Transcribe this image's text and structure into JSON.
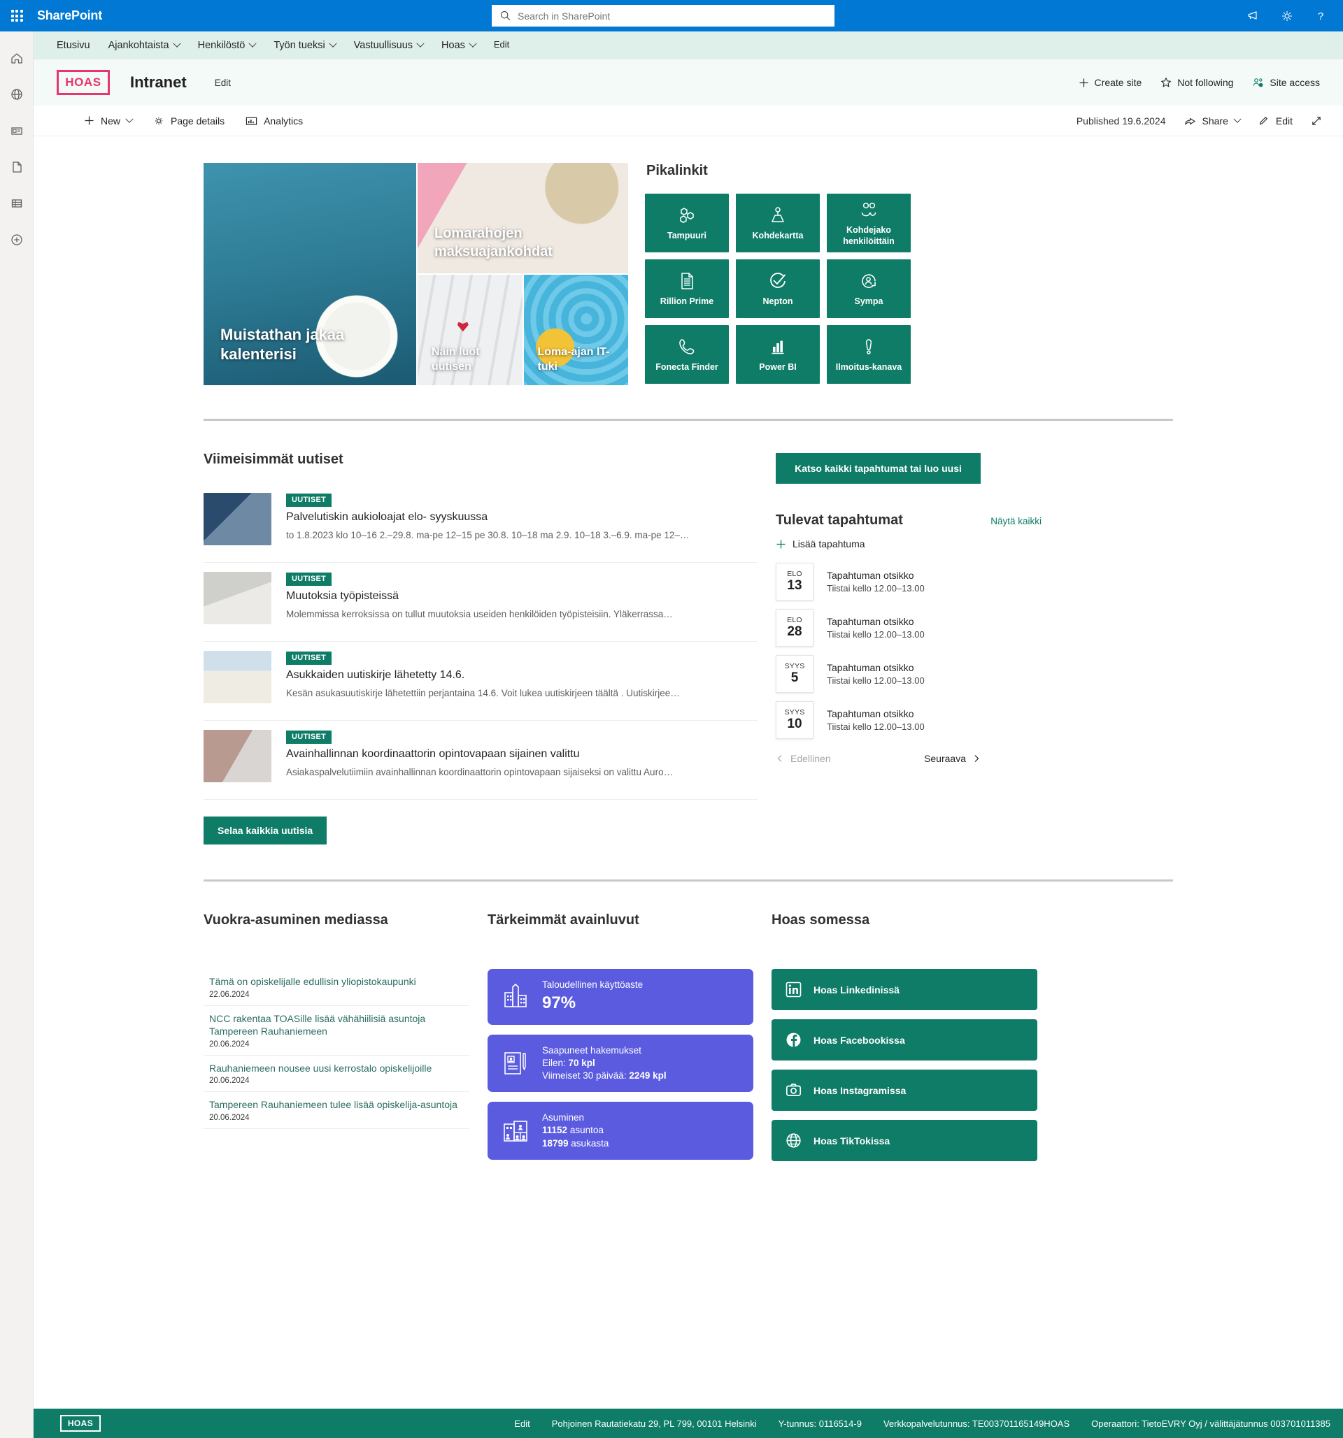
{
  "suite": {
    "brand": "SharePoint",
    "search_placeholder": "Search in SharePoint",
    "icons": [
      "megaphone-icon",
      "gear-icon",
      "help-icon"
    ]
  },
  "rail": {
    "items": [
      "home-icon",
      "globe-icon",
      "news-icon",
      "page-icon",
      "list-icon",
      "create-icon"
    ]
  },
  "topnav": {
    "items": [
      {
        "label": "Etusivu",
        "has_chevron": false
      },
      {
        "label": "Ajankohtaista",
        "has_chevron": true
      },
      {
        "label": "Henkilöstö",
        "has_chevron": true
      },
      {
        "label": "Työn tueksi",
        "has_chevron": true
      },
      {
        "label": "Vastuullisuus",
        "has_chevron": true
      },
      {
        "label": "Hoas",
        "has_chevron": true
      }
    ],
    "edit": "Edit"
  },
  "site_header": {
    "logo_text": "HOAS",
    "title": "Intranet",
    "edit": "Edit",
    "actions": [
      {
        "label": "Create site",
        "icon": "plus-icon"
      },
      {
        "label": "Not following",
        "icon": "star-icon"
      },
      {
        "label": "Site access",
        "icon": "people-icon"
      }
    ]
  },
  "cmdbar": {
    "new_label": "New",
    "page_details_label": "Page details",
    "analytics_label": "Analytics",
    "published": "Published 19.6.2024",
    "share_label": "Share",
    "edit_label": "Edit"
  },
  "hero": {
    "tiles": [
      {
        "caption": "Muistathan jakaa kalenterisi",
        "theme": "t-clock",
        "size": "big"
      },
      {
        "caption": "Lomarahojen maksuajankohdat",
        "theme": "t-phone",
        "size": "wide"
      },
      {
        "caption": "Näin luot uutisen",
        "theme": "t-keyboard",
        "size": "small"
      },
      {
        "caption": "Loma-ajan IT-tuki",
        "theme": "t-pool",
        "size": "small"
      }
    ]
  },
  "quicklinks": {
    "title": "Pikalinkit",
    "items": [
      {
        "label": "Tampuuri",
        "icon": "hexagons-icon"
      },
      {
        "label": "Kohdekartta",
        "icon": "map-pin-icon"
      },
      {
        "label": "Kohdejako henkilöittäin",
        "icon": "people-icon"
      },
      {
        "label": "Rillion Prime",
        "icon": "document-icon"
      },
      {
        "label": "Nepton",
        "icon": "check-circle-icon"
      },
      {
        "label": "Sympa",
        "icon": "person-refresh-icon"
      },
      {
        "label": "Fonecta Finder",
        "icon": "phone-icon"
      },
      {
        "label": "Power BI",
        "icon": "bar-chart-icon"
      },
      {
        "label": "Ilmoitus-kanava",
        "icon": "alert-icon"
      }
    ]
  },
  "news": {
    "title": "Viimeisimmät uutiset",
    "browse_all": "Selaa kaikkia uutisia",
    "items": [
      {
        "badge": "UUTISET",
        "title": "Palvelutiskin aukioloajat elo- syyskuussa",
        "desc": "to 1.8.2023 klo 10–16 2.–29.8. ma-pe 12–15 pe 30.8. 10–18 ma 2.9. 10–18 3.–6.9. ma-pe 12–…",
        "thumb": "thumb-a"
      },
      {
        "badge": "UUTISET",
        "title": "Muutoksia työpisteissä",
        "desc": "Molemmissa kerroksissa on tullut muutoksia useiden henkilöiden työpisteisiin. Yläkerrassa…",
        "thumb": "thumb-b"
      },
      {
        "badge": "UUTISET",
        "title": "Asukkaiden uutiskirje lähetetty 14.6.",
        "desc": "Kesän asukasuutiskirje lähetettiin perjantaina 14.6. Voit lukea uutiskirjeen täältä . Uutiskirjee…",
        "thumb": "thumb-c"
      },
      {
        "badge": "UUTISET",
        "title": "Avainhallinnan koordinaattorin opintovapaan sijainen valittu",
        "desc": "Asiakaspalvelutiimiin avainhallinnan koordinaattorin opintovapaan sijaiseksi on valittu Auro…",
        "thumb": "thumb-d"
      }
    ]
  },
  "events": {
    "cta": "Katso kaikki tapahtumat tai luo uusi",
    "title": "Tulevat tapahtumat",
    "show_all": "Näytä kaikki",
    "add": "Lisää tapahtuma",
    "prev": "Edellinen",
    "next": "Seuraava",
    "items": [
      {
        "month": "ELO",
        "day": "13",
        "title": "Tapahtuman otsikko",
        "time": "Tiistai kello 12.00–13.00"
      },
      {
        "month": "ELO",
        "day": "28",
        "title": "Tapahtuman otsikko",
        "time": "Tiistai kello 12.00–13.00"
      },
      {
        "month": "SYYS",
        "day": "5",
        "title": "Tapahtuman otsikko",
        "time": "Tiistai kello 12.00–13.00"
      },
      {
        "month": "SYYS",
        "day": "10",
        "title": "Tapahtuman otsikko",
        "time": "Tiistai kello 12.00–13.00"
      }
    ]
  },
  "media": {
    "title": "Vuokra-asuminen mediassa",
    "items": [
      {
        "title": "Tämä on opiskelijalle edullisin yliopistokaupunki",
        "date": "22.06.2024"
      },
      {
        "title": "NCC rakentaa TOASille lisää vähähiilisiä asuntoja Tampereen Rauhaniemeen",
        "date": "20.06.2024"
      },
      {
        "title": "Rauhaniemeen nousee uusi kerrostalo opiskelijoille",
        "date": "20.06.2024"
      },
      {
        "title": "Tampereen Rauhaniemeen tulee lisää opiskelija-asuntoja",
        "date": "20.06.2024"
      }
    ]
  },
  "kpi": {
    "title": "Tärkeimmät avainluvut",
    "cards": [
      {
        "icon": "buildings-icon",
        "label": "Taloudellinen käyttöaste",
        "big": "97%"
      },
      {
        "icon": "application-icon",
        "label": "Saapuneet hakemukset",
        "row1_pre": "Eilen: ",
        "row1_val": "70 kpl",
        "row2_pre": "Viimeiset 30 päivää: ",
        "row2_val": "2249 kpl"
      },
      {
        "icon": "housing-icon",
        "label": "Asuminen",
        "row1_val": "11152",
        "row1_post": " asuntoa",
        "row2_val": "18799",
        "row2_post": " asukasta"
      }
    ]
  },
  "social": {
    "title": "Hoas somessa",
    "items": [
      {
        "label": "Hoas Linkedinissä",
        "icon": "linkedin-icon"
      },
      {
        "label": "Hoas Facebookissa",
        "icon": "facebook-icon"
      },
      {
        "label": "Hoas Instagramissa",
        "icon": "instagram-icon"
      },
      {
        "label": "Hoas TikTokissa",
        "icon": "globe-icon"
      }
    ]
  },
  "footer": {
    "logo_text": "HOAS",
    "edit": "Edit",
    "address": "Pohjoinen Rautatiekatu 29, PL 799, 00101 Helsinki",
    "business_id": "Y-tunnus: 0116514-9",
    "service_id": "Verkkopalvelutunnus: TE003701165149HOAS",
    "operator": "Operaattori: TietoEVRY Oyj / välittäjätunnus 003701011385"
  },
  "colors": {
    "brand_blue": "#0078d4",
    "hoas_green": "#0e7c66",
    "hoas_pink": "#e8356d",
    "nav_bg": "#dff0ea",
    "kpi_purple": "#5b5be0"
  }
}
